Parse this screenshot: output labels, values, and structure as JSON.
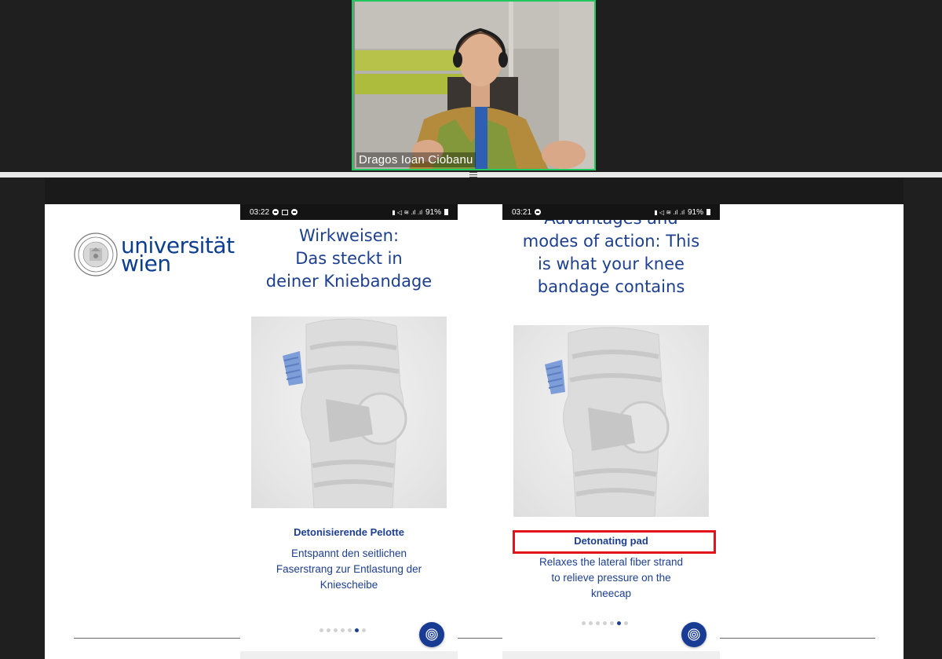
{
  "meeting": {
    "participant_name": "Dragos Ioan Ciobanu",
    "accent_color": "#23c55e"
  },
  "slide": {
    "logo_line1": "universität",
    "logo_line2": "wien",
    "brand_color": "#0b3d91"
  },
  "phone_german": {
    "status_time": "03:22",
    "status_battery": "91%",
    "title_lines": [
      "Wirkweisen:",
      "Das steckt in",
      "deiner Kniebandage"
    ],
    "feature_title": "Detonisierende Pelotte",
    "feature_desc": "Entspannt den seitlichen\nFaserstrang zur Entlastung der\nKniescheibe",
    "page_dots": 7,
    "active_dot": 5
  },
  "phone_english": {
    "status_time": "03:21",
    "status_battery": "91%",
    "title_lines": [
      "Advantages and",
      "modes of action: This",
      "is what your knee",
      "bandage contains"
    ],
    "feature_title": "Detonating pad",
    "feature_desc": "Relaxes the lateral fiber strand\nto relieve pressure on the\nkneecap",
    "page_dots": 7,
    "active_dot": 5,
    "highlight_color": "#e3131b"
  },
  "icons": {
    "fingerprint": "fingerprint-icon",
    "seal": "university-seal-icon"
  }
}
